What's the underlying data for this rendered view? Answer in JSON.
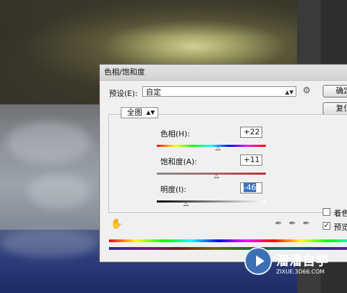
{
  "dialog": {
    "title": "色相/饱和度",
    "preset_label": "预设(E):",
    "preset_value": "自定",
    "ok_label": "确定",
    "reset_label": "复位"
  },
  "channel": {
    "value": "全图"
  },
  "hue": {
    "label": "色相(H):",
    "value": "+22",
    "level": 0.56
  },
  "saturation": {
    "label": "饱和度(A):",
    "value": "+11",
    "level": 0.55
  },
  "lightness": {
    "label": "明度(I):",
    "value": "-46",
    "level": 0.27
  },
  "options": {
    "colorize_label": "着色",
    "colorize_checked": false,
    "preview_label": "预览",
    "preview_checked": true
  },
  "icons": {
    "gear": "gear-icon",
    "hand": "hand-adjust-icon",
    "eyedropper": "eyedropper-icon",
    "eyedropper_plus": "eyedropper-plus-icon",
    "eyedropper_minus": "eyedropper-minus-icon",
    "watermark": "play-logo-icon"
  },
  "watermark": {
    "title": "溜溜自学",
    "url": "ZIXUE.3D66.COM"
  }
}
